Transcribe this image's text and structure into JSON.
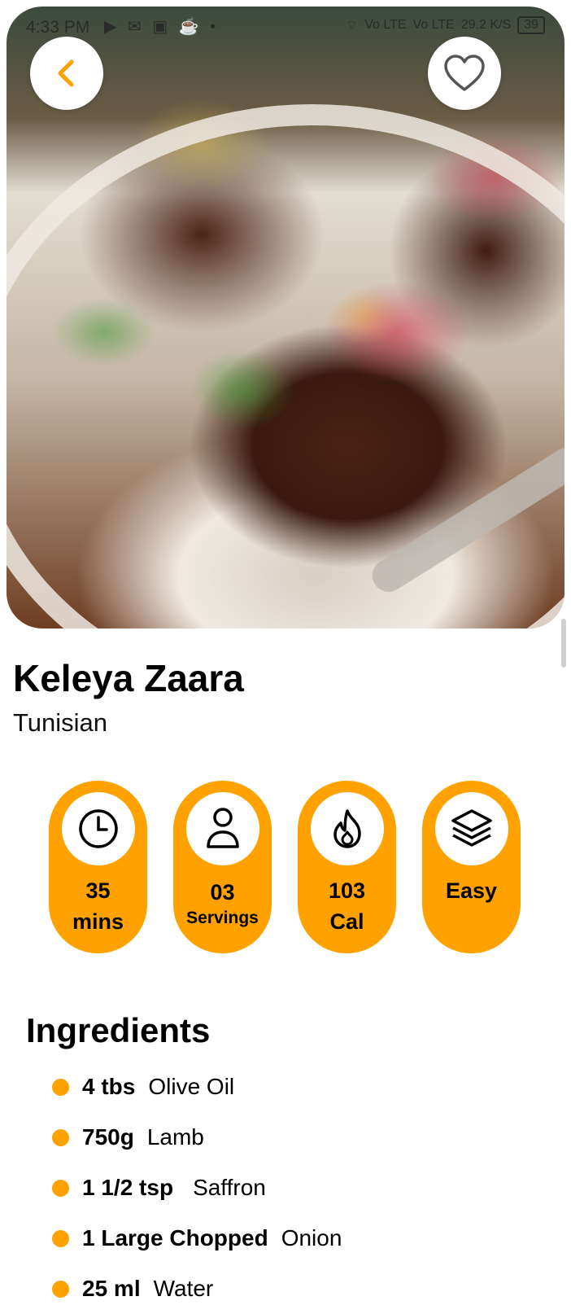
{
  "status_bar": {
    "time": "4:33 PM",
    "network": "Vo LTE",
    "network2": "Vo LTE",
    "speed": "29.2 K/S",
    "battery": "39"
  },
  "recipe": {
    "title": "Keleya Zaara",
    "cuisine": "Tunisian"
  },
  "stats": [
    {
      "icon": "clock-icon",
      "line1": "35",
      "line2": "mins"
    },
    {
      "icon": "person-icon",
      "line1": "03",
      "line2": "Servings"
    },
    {
      "icon": "flame-icon",
      "line1": "103",
      "line2": "Cal"
    },
    {
      "icon": "layers-icon",
      "line1": "Easy",
      "line2": ""
    }
  ],
  "ingredients": {
    "title": "Ingredients",
    "items": [
      {
        "qty": "4 tbs",
        "name": "Olive Oil"
      },
      {
        "qty": "750g",
        "name": "Lamb"
      },
      {
        "qty": "1 1/2 tsp",
        "name": "Saffron"
      },
      {
        "qty": "1 Large Chopped",
        "name": "Onion"
      },
      {
        "qty": "25 ml",
        "name": "Water"
      }
    ]
  },
  "colors": {
    "accent": "#FFA200",
    "background": "#FFFFFF",
    "text": "#000000"
  }
}
